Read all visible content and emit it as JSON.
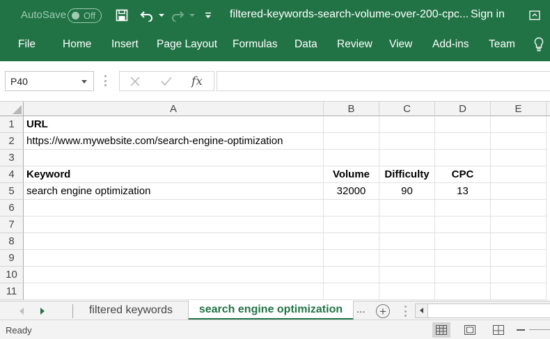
{
  "titlebar": {
    "autosave_label": "AutoSave",
    "autosave_state": "Off",
    "filename": "filtered-keywords-search-volume-over-200-cpc...",
    "signin": "Sign in",
    "icons": [
      "save-icon",
      "undo-icon",
      "redo-icon",
      "customize-qat-icon",
      "ribbon-display-icon"
    ]
  },
  "ribbon": {
    "tabs": [
      "File",
      "Home",
      "Insert",
      "Page Layout",
      "Formulas",
      "Data",
      "Review",
      "View",
      "Add-ins",
      "Team"
    ],
    "tell_me_icon": "lightbulb-icon"
  },
  "formula_bar": {
    "name_box": "P40",
    "fx_label": "fx",
    "formula": ""
  },
  "grid": {
    "columns": [
      "A",
      "B",
      "C",
      "D",
      "E"
    ],
    "rows": [
      "1",
      "2",
      "3",
      "4",
      "5",
      "6",
      "7",
      "8",
      "9",
      "10",
      "11"
    ],
    "cells": {
      "A1": "URL",
      "A2": "https://www.mywebsite.com/search-engine-optimization",
      "A4": "Keyword",
      "B4": "Volume",
      "C4": "Difficulty",
      "D4": "CPC",
      "A5": "search engine optimization",
      "B5": "32000",
      "C5": "90",
      "D5": "13"
    }
  },
  "sheet_tabs": {
    "tabs": [
      "filtered keywords",
      "search engine optimization"
    ],
    "active_index": 1,
    "more": "...",
    "add": "+"
  },
  "status_bar": {
    "status": "Ready",
    "accent": "#217346"
  }
}
